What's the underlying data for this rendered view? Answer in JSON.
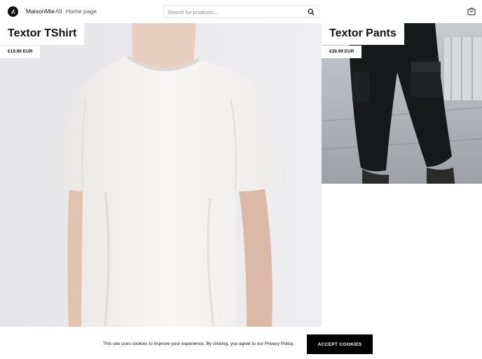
{
  "header": {
    "brand": "MaisonMie",
    "nav": [
      {
        "label": "All"
      },
      {
        "label": "Home page"
      }
    ],
    "search": {
      "placeholder": "Search for products...",
      "icon": "search-icon"
    },
    "cart_icon": "shopping-bag-icon"
  },
  "products": [
    {
      "title": "Textor TShirt",
      "price": "€19.99 EUR",
      "image": "white-tshirt-photo"
    },
    {
      "title": "Textor Pants",
      "price": "€39.99 EUR",
      "image": "black-cargo-pants-photo"
    }
  ],
  "cookie_banner": {
    "text": "This site uses cookies to improve your experience. By clicking, you agree to our Privacy Policy.",
    "button_label": "ACCEPT COOKIES"
  },
  "colors": {
    "accent": "#000000",
    "background": "#ffffff"
  }
}
